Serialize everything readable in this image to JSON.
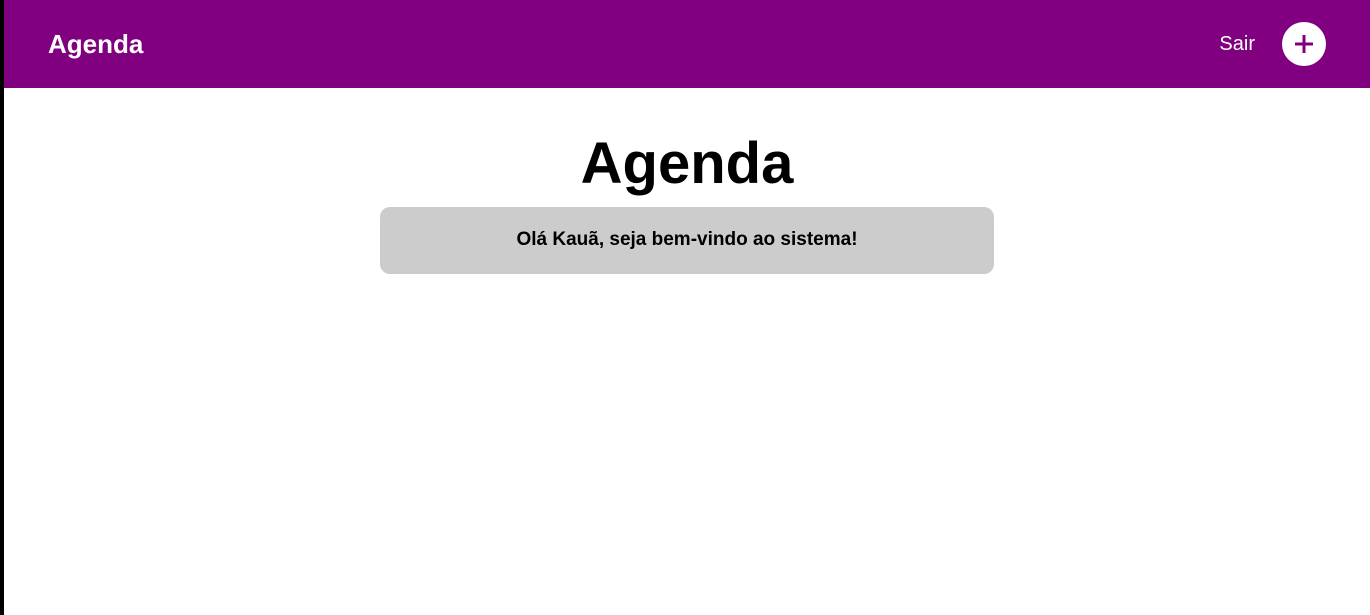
{
  "navbar": {
    "brand": "Agenda",
    "logout_label": "Sair",
    "add_icon": "plus-icon",
    "background_color": "#800080",
    "text_color": "#ffffff"
  },
  "main": {
    "title": "Agenda",
    "welcome_message": "Olá Kauã, seja bem-vindo ao sistema!",
    "welcome_box_color": "#cccccc"
  }
}
